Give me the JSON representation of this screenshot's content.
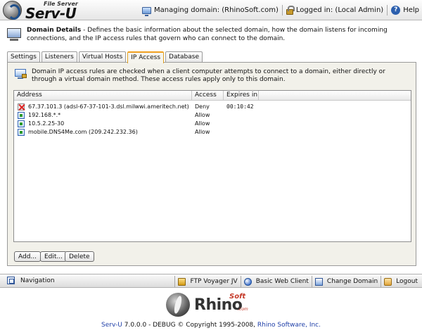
{
  "header": {
    "logo_sub": "File Server",
    "logo_main": "Serv-U",
    "managing_domain": "Managing domain: (RhinoSoft.com)",
    "logged_in": "Logged in: (Local Admin)",
    "help": "Help"
  },
  "details": {
    "title": "Domain Details",
    "description": " - Defines the basic information about the selected domain, how the domain listens for incoming connections, and the IP access rules that govern who can connect to the domain."
  },
  "tabs": [
    {
      "label": "Settings",
      "active": false
    },
    {
      "label": "Listeners",
      "active": false
    },
    {
      "label": "Virtual Hosts",
      "active": false
    },
    {
      "label": "IP Access",
      "active": true
    },
    {
      "label": "Database",
      "active": false
    }
  ],
  "ip_access": {
    "info": "Domain IP access rules are checked when a client computer attempts to connect to a domain, either directly or through a virtual domain method. These access rules apply only to this domain.",
    "columns": {
      "address": "Address",
      "access": "Access",
      "expires": "Expires in"
    },
    "rows": [
      {
        "address": "67.37.101.3 (adsl-67-37-101-3.dsl.milwwi.ameritech.net)",
        "access": "Deny",
        "expires": "00:10:42",
        "icon": "deny-rule-icon"
      },
      {
        "address": "192.168.*.*",
        "access": "Allow",
        "expires": "",
        "icon": "allow-rule-icon"
      },
      {
        "address": "10.5.2.25-30",
        "access": "Allow",
        "expires": "",
        "icon": "allow-rule-icon"
      },
      {
        "address": "mobile.DNS4Me.com (209.242.232.36)",
        "access": "Allow",
        "expires": "",
        "icon": "allow-rule-icon"
      }
    ],
    "buttons": {
      "add": "Add...",
      "edit": "Edit...",
      "delete": "Delete"
    }
  },
  "toolbar": {
    "navigation": "Navigation",
    "ftp_voyager": "FTP Voyager JV",
    "basic_web_client": "Basic Web Client",
    "change_domain": "Change Domain",
    "logout": "Logout"
  },
  "footer": {
    "logo_main": "Rhino",
    "logo_sub": "Soft",
    "logo_com": ".com",
    "product_link": "Serv-U",
    "copyright_text": " 7.0.0.0 - DEBUG © Copyright 1995-2008, ",
    "company_link": "Rhino Software, Inc."
  },
  "colors": {
    "active_tab_accent": "#f0a020",
    "link": "#1f3fa8",
    "panel_bg": "#f2f1ea"
  }
}
